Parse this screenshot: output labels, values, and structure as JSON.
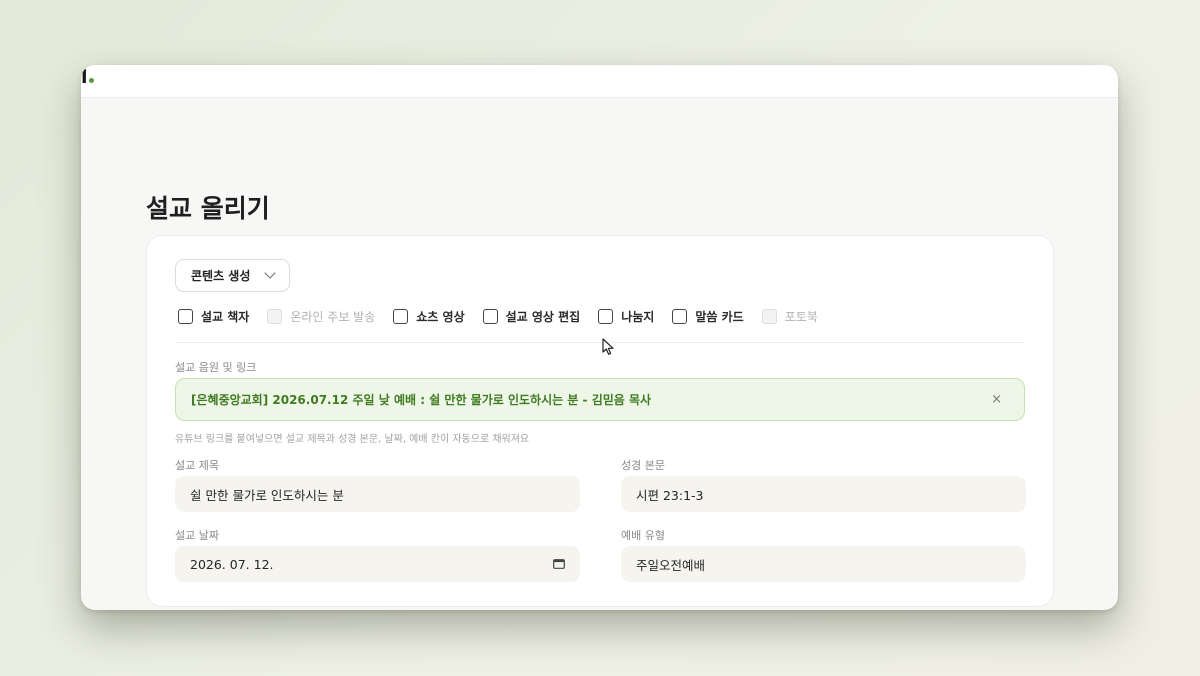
{
  "window": {
    "logo_text": "l",
    "accent_color": "#5a9a3a"
  },
  "page": {
    "title": "설교 올리기"
  },
  "dropdown": {
    "label": "콘텐츠 생성"
  },
  "options": [
    {
      "label": "설교 책자",
      "checked": false,
      "disabled": false
    },
    {
      "label": "온라인 주보 발송",
      "checked": false,
      "disabled": true
    },
    {
      "label": "쇼츠 영상",
      "checked": false,
      "disabled": false
    },
    {
      "label": "설교 영상 편집",
      "checked": false,
      "disabled": false
    },
    {
      "label": "나눔지",
      "checked": false,
      "disabled": false
    },
    {
      "label": "말씀 카드",
      "checked": false,
      "disabled": false
    },
    {
      "label": "포토북",
      "checked": false,
      "disabled": true
    }
  ],
  "audio_link": {
    "label": "설교 음원 및 링크",
    "value": "[은혜중앙교회] 2026.07.12 주일 낮 예배 : 쉴 만한 물가로 인도하시는 분 - 김믿음 목사",
    "close_glyph": "×",
    "hint": "유튜브 링크를 붙여넣으면 설교 제목과 성경 본문, 날짜, 예배 칸이 자동으로 채워져요"
  },
  "fields": {
    "sermon_title": {
      "label": "설교 제목",
      "value": "쉴 만한 물가로 인도하시는 분"
    },
    "scripture": {
      "label": "성경 본문",
      "value": "시편 23:1-3"
    },
    "sermon_date": {
      "label": "설교 날짜",
      "value": "2026. 07. 12."
    },
    "service_type": {
      "label": "예배 유형",
      "value": "주일오전예배"
    }
  }
}
